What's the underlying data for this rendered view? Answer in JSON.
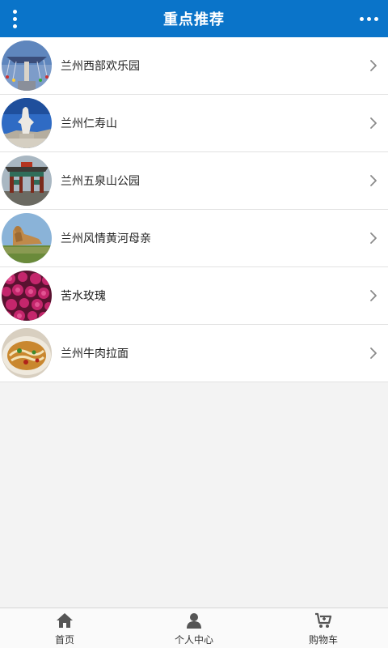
{
  "header": {
    "title": "重点推荐",
    "menu_icon": "vertical-dots-icon",
    "more_icon": "horizontal-dots-icon",
    "background": "#0a74c9"
  },
  "list": {
    "items": [
      {
        "label": "兰州西部欢乐园",
        "thumb": "amusement-park-swing"
      },
      {
        "label": "兰州仁寿山",
        "thumb": "mountain-statue"
      },
      {
        "label": "兰州五泉山公园",
        "thumb": "park-gate"
      },
      {
        "label": "兰州风情黄河母亲",
        "thumb": "yellow-river-mother-statue"
      },
      {
        "label": "苦水玫瑰",
        "thumb": "roses"
      },
      {
        "label": "兰州牛肉拉面",
        "thumb": "beef-noodles"
      }
    ],
    "chevron_icon": "chevron-right-icon"
  },
  "bottom_nav": {
    "items": [
      {
        "label": "首页",
        "icon": "home-icon"
      },
      {
        "label": "个人中心",
        "icon": "user-icon"
      },
      {
        "label": "购物车",
        "icon": "cart-icon"
      }
    ]
  }
}
